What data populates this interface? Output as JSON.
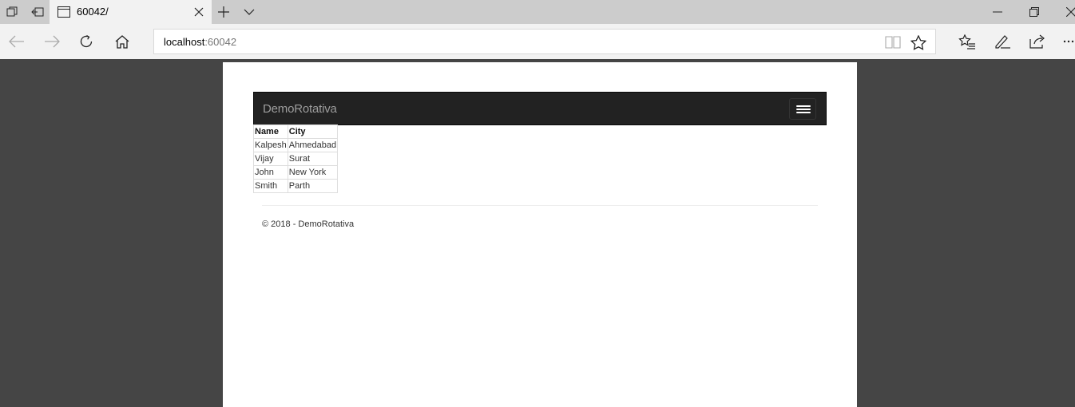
{
  "browser": {
    "tab": {
      "title": "60042/"
    },
    "address": {
      "host": "localhost",
      "port": ":60042"
    }
  },
  "page": {
    "brand": "DemoRotativa",
    "table": {
      "headers": [
        "Name",
        "City"
      ],
      "rows": [
        [
          "Kalpesh",
          "Ahmedabad"
        ],
        [
          "Vijay",
          "Surat"
        ],
        [
          "John",
          "New York"
        ],
        [
          "Smith",
          "Parth"
        ]
      ]
    },
    "footer": "© 2018 - DemoRotativa"
  }
}
